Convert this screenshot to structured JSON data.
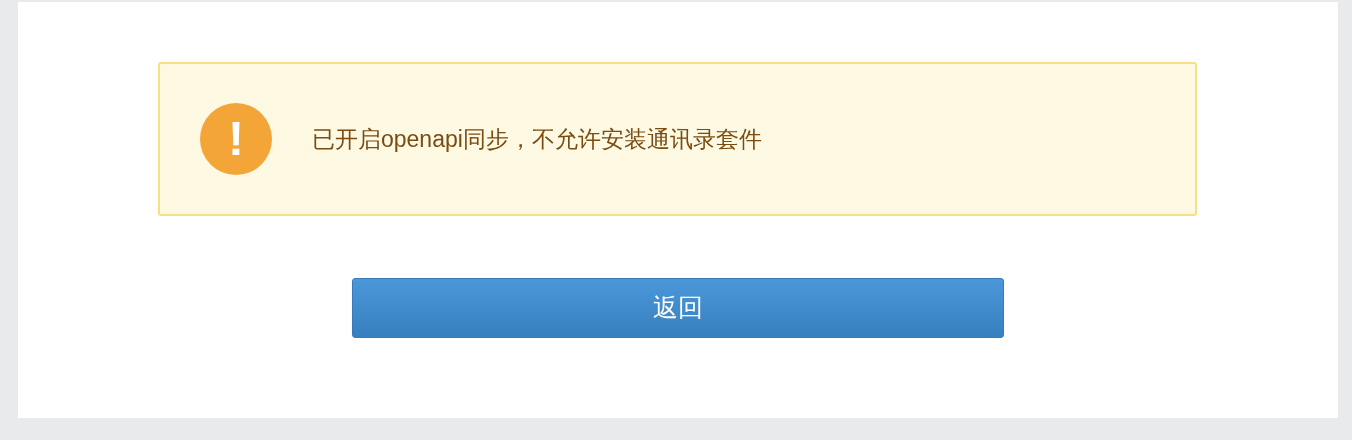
{
  "alert": {
    "kind": "warning",
    "icon": "!",
    "message": "已开启openapi同步，不允许安装通讯录套件"
  },
  "buttons": [
    {
      "label": "返回"
    }
  ]
}
